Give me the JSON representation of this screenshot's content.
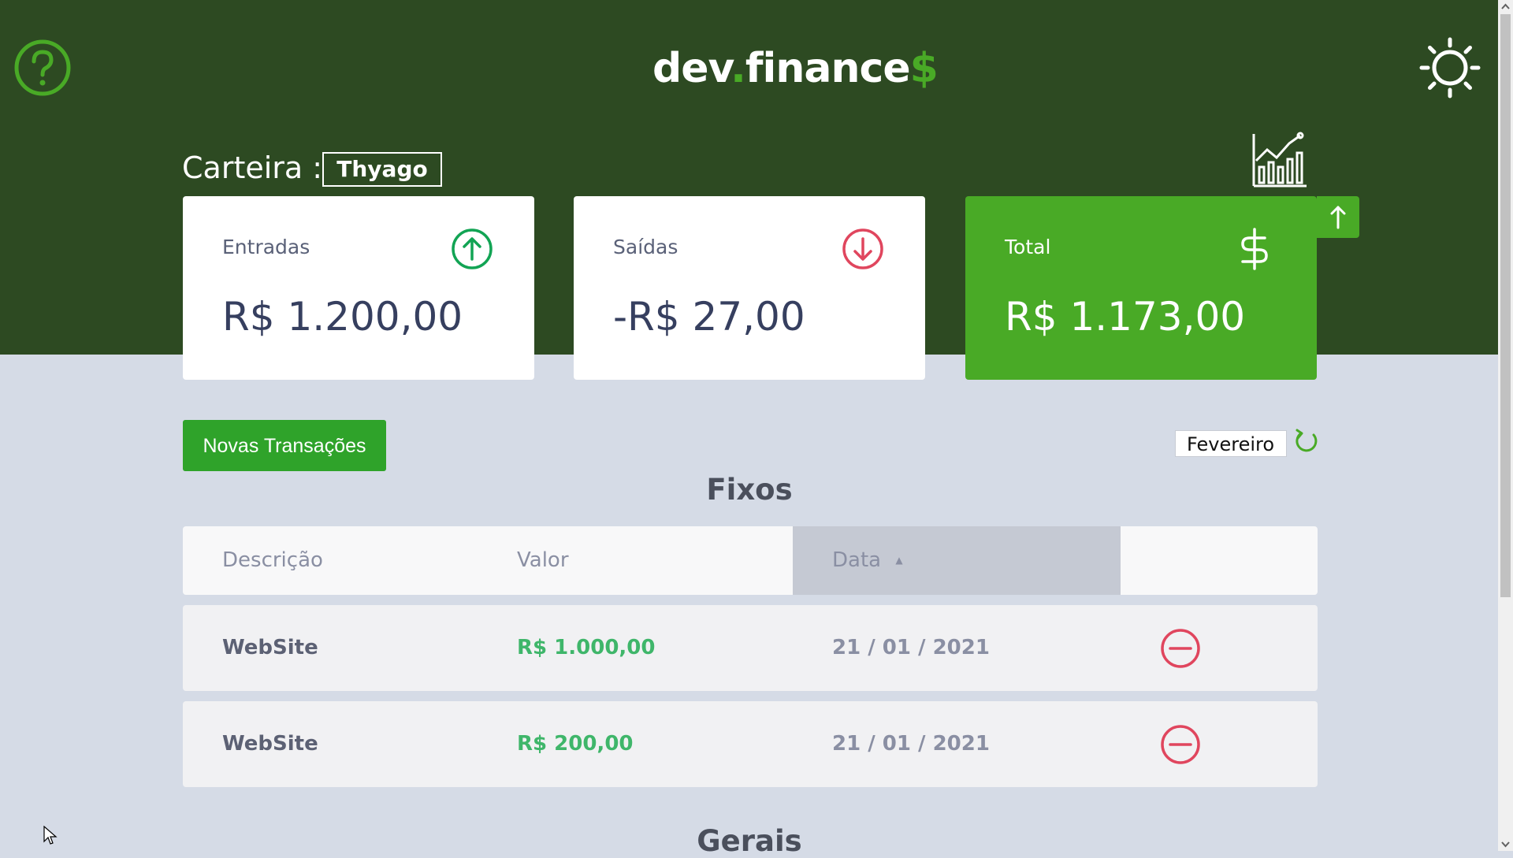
{
  "app": {
    "logo_main": "dev",
    "logo_dot": ".",
    "logo_rest": "finance",
    "logo_dollar": "$"
  },
  "header": {
    "help_icon": "question-circle-icon",
    "theme_icon": "sun-icon",
    "chart_icon": "bar-chart-trend-icon"
  },
  "wallet": {
    "label": "Carteira :",
    "name": "Thyago"
  },
  "cards": {
    "income": {
      "title": "Entradas",
      "value": "R$ 1.200,00",
      "icon": "arrow-up-circle-icon"
    },
    "expense": {
      "title": "Saídas",
      "value": "-R$ 27,00",
      "icon": "arrow-down-circle-icon"
    },
    "total": {
      "title": "Total",
      "value": "R$ 1.173,00",
      "icon": "dollar-icon"
    }
  },
  "actions": {
    "new_transaction": "Novas Transações",
    "month": "Fevereiro",
    "refresh_icon": "refresh-icon",
    "scroll_top_icon": "arrow-up-icon"
  },
  "sections": {
    "fixed_title": "Fixos",
    "general_title": "Gerais"
  },
  "table": {
    "headers": [
      "Descrição",
      "Valor",
      "Data"
    ],
    "sort_indicator": "▲",
    "rows": [
      {
        "description": "WebSite",
        "amount": "R$ 1.000,00",
        "date": "21 / 01 / 2021"
      },
      {
        "description": "WebSite",
        "amount": "R$ 200,00",
        "date": "21 / 01 / 2021"
      }
    ]
  },
  "colors": {
    "header_bg": "#2d4a22",
    "accent": "#49aa26",
    "income": "#12a454",
    "expense": "#e92929",
    "page_bg": "#d5dbe6"
  }
}
